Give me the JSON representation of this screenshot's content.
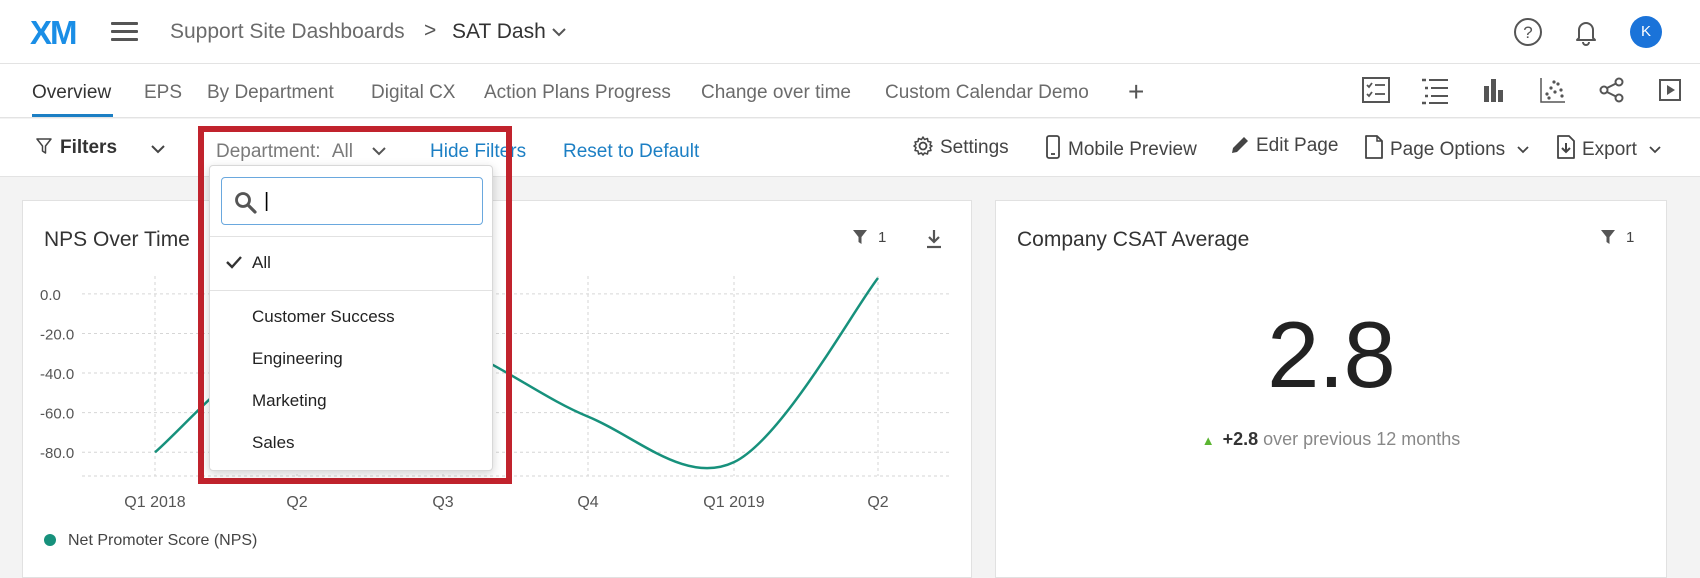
{
  "header": {
    "logo": "XM",
    "breadcrumb_root": "Support Site Dashboards",
    "breadcrumb_sep": ">",
    "breadcrumb_current": "SAT Dash",
    "avatar_initial": "K",
    "icons": [
      "help-icon",
      "bell-icon"
    ]
  },
  "tabs": [
    "Overview",
    "EPS",
    "By Department",
    "Digital CX",
    "Action Plans Progress",
    "Change over time",
    "Custom Calendar Demo"
  ],
  "tab_add": "+",
  "tab_tools": [
    "checklist-icon",
    "list-icon",
    "bar-chart-icon",
    "scatter-icon",
    "share-icon",
    "present-icon"
  ],
  "filterbar": {
    "filters_label": "Filters",
    "department_label": "Department:",
    "department_value": "All",
    "hide_filters": "Hide Filters",
    "reset": "Reset to Default",
    "settings": "Settings",
    "mobile_preview": "Mobile Preview",
    "edit_page": "Edit Page",
    "page_options": "Page Options",
    "export": "Export"
  },
  "dropdown": {
    "search_value": "|",
    "selected": "All",
    "options": [
      "Customer Success",
      "Engineering",
      "Marketing",
      "Sales"
    ]
  },
  "nps_widget": {
    "title": "NPS Over Time",
    "filter_count": "1",
    "legend": "Net Promoter Score (NPS)"
  },
  "csat_widget": {
    "title": "Company CSAT Average",
    "filter_count": "1",
    "value": "2.8",
    "change_value": "+2.8",
    "change_text": "over previous 12 months"
  },
  "chart_data": {
    "type": "line",
    "title": "NPS Over Time",
    "categories": [
      "Q1 2018",
      "Q2",
      "Q3",
      "Q4",
      "Q1 2019",
      "Q2"
    ],
    "series": [
      {
        "name": "Net Promoter Score (NPS)",
        "values": [
          -80,
          -20,
          -25,
          -62,
          -85,
          8
        ]
      }
    ],
    "y_ticks": [
      "0.0",
      "-20.0",
      "-40.0",
      "-60.0",
      "-80.0"
    ],
    "ylim": [
      -92,
      8
    ],
    "grid": true,
    "legend": "bottom-left",
    "color": "#17917c"
  },
  "colors": {
    "accent": "#1c7fc4",
    "highlight": "#c1232d",
    "series": "#17917c"
  }
}
